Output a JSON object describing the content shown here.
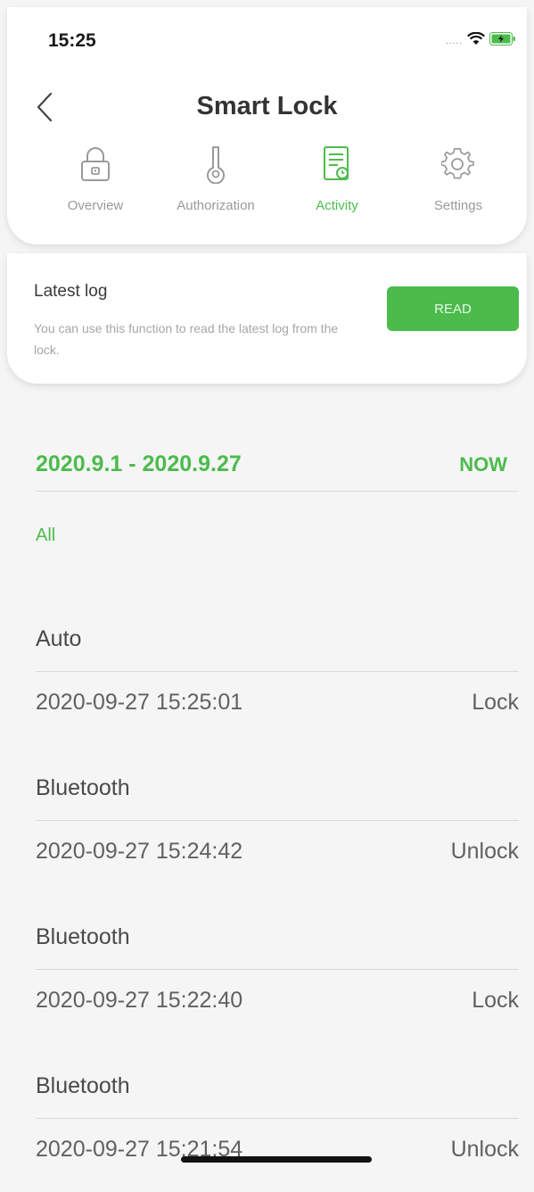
{
  "status_bar": {
    "time": "15:25",
    "signal": "....."
  },
  "header": {
    "title": "Smart Lock"
  },
  "tabs": [
    {
      "label": "Overview",
      "icon": "lock-icon",
      "active": false
    },
    {
      "label": "Authorization",
      "icon": "key-icon",
      "active": false
    },
    {
      "label": "Activity",
      "icon": "log-list-icon",
      "active": true
    },
    {
      "label": "Settings",
      "icon": "gear-icon",
      "active": false
    }
  ],
  "latest_log": {
    "title": "Latest log",
    "description": "You can use this function to read the latest log from the lock.",
    "button_label": "READ"
  },
  "filter": {
    "date_range": "2020.9.1 - 2020.9.27",
    "now_label": "NOW",
    "type_label": "All"
  },
  "log_groups": [
    {
      "source": "Auto",
      "time": "2020-09-27 15:25:01",
      "action": "Lock"
    },
    {
      "source": "Bluetooth",
      "time": "2020-09-27 15:24:42",
      "action": "Unlock"
    },
    {
      "source": "Bluetooth",
      "time": "2020-09-27 15:22:40",
      "action": "Lock"
    },
    {
      "source": "Bluetooth",
      "time": "2020-09-27 15:21:54",
      "action": "Unlock"
    }
  ],
  "colors": {
    "accent": "#4cbb4c",
    "inactive": "#9a9a9a",
    "background": "#f5f5f5"
  }
}
